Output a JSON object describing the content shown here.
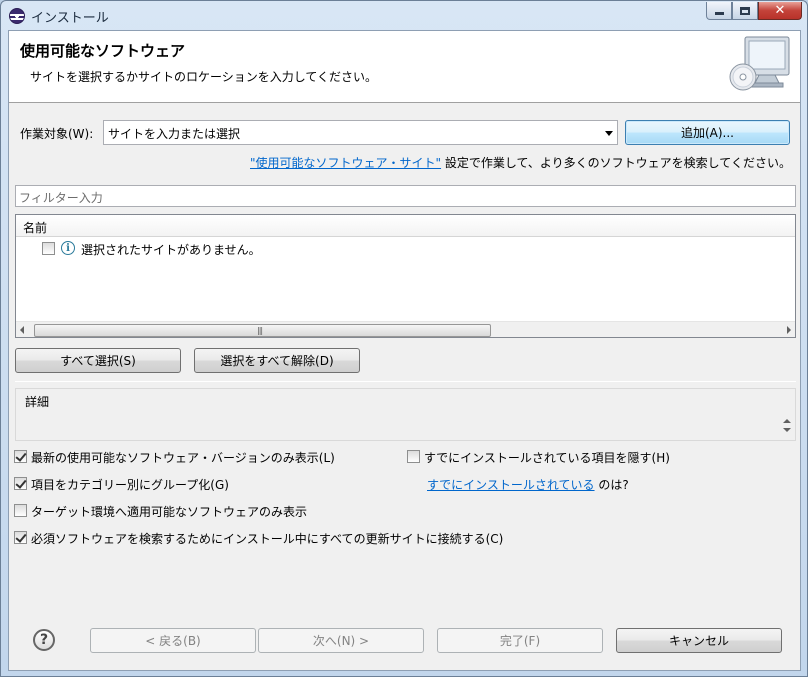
{
  "window": {
    "title": "インストール"
  },
  "banner": {
    "title": "使用可能なソフトウェア",
    "description": "サイトを選択するかサイトのロケーションを入力してください。"
  },
  "work_with": {
    "label": "作業対象(W):",
    "value": "サイトを入力または選択",
    "add_button": "追加(A)..."
  },
  "sites_hint": {
    "link": "\"使用可能なソフトウェア・サイト\"",
    "text": " 設定で作業して、より多くのソフトウェアを検索してください。"
  },
  "filter": {
    "placeholder": "フィルター入力"
  },
  "tree": {
    "column_header": "名前",
    "items": [
      {
        "label": "選択されたサイトがありません。",
        "checked": false
      }
    ]
  },
  "select_buttons": {
    "select_all": "すべて選択(S)",
    "deselect_all": "選択をすべて解除(D)"
  },
  "details": {
    "label": "詳細"
  },
  "options": {
    "show_latest": {
      "label": "最新の使用可能なソフトウェア・バージョンのみ表示(L)",
      "checked": true
    },
    "hide_installed": {
      "label": "すでにインストールされている項目を隠す(H)",
      "checked": false
    },
    "group_by_category": {
      "label": "項目をカテゴリー別にグループ化(G)",
      "checked": true
    },
    "already_installed_link": "すでにインストールされている",
    "already_installed_suffix": " のは?",
    "target_env_only": {
      "label": "ターゲット環境へ適用可能なソフトウェアのみ表示",
      "checked": false
    },
    "contact_all_sites": {
      "label": "必須ソフトウェアを検索するためにインストール中にすべての更新サイトに接続する(C)",
      "checked": true
    }
  },
  "footer": {
    "back": "< 戻る(B)",
    "next": "次へ(N) >",
    "finish": "完了(F)",
    "cancel": "キャンセル"
  }
}
